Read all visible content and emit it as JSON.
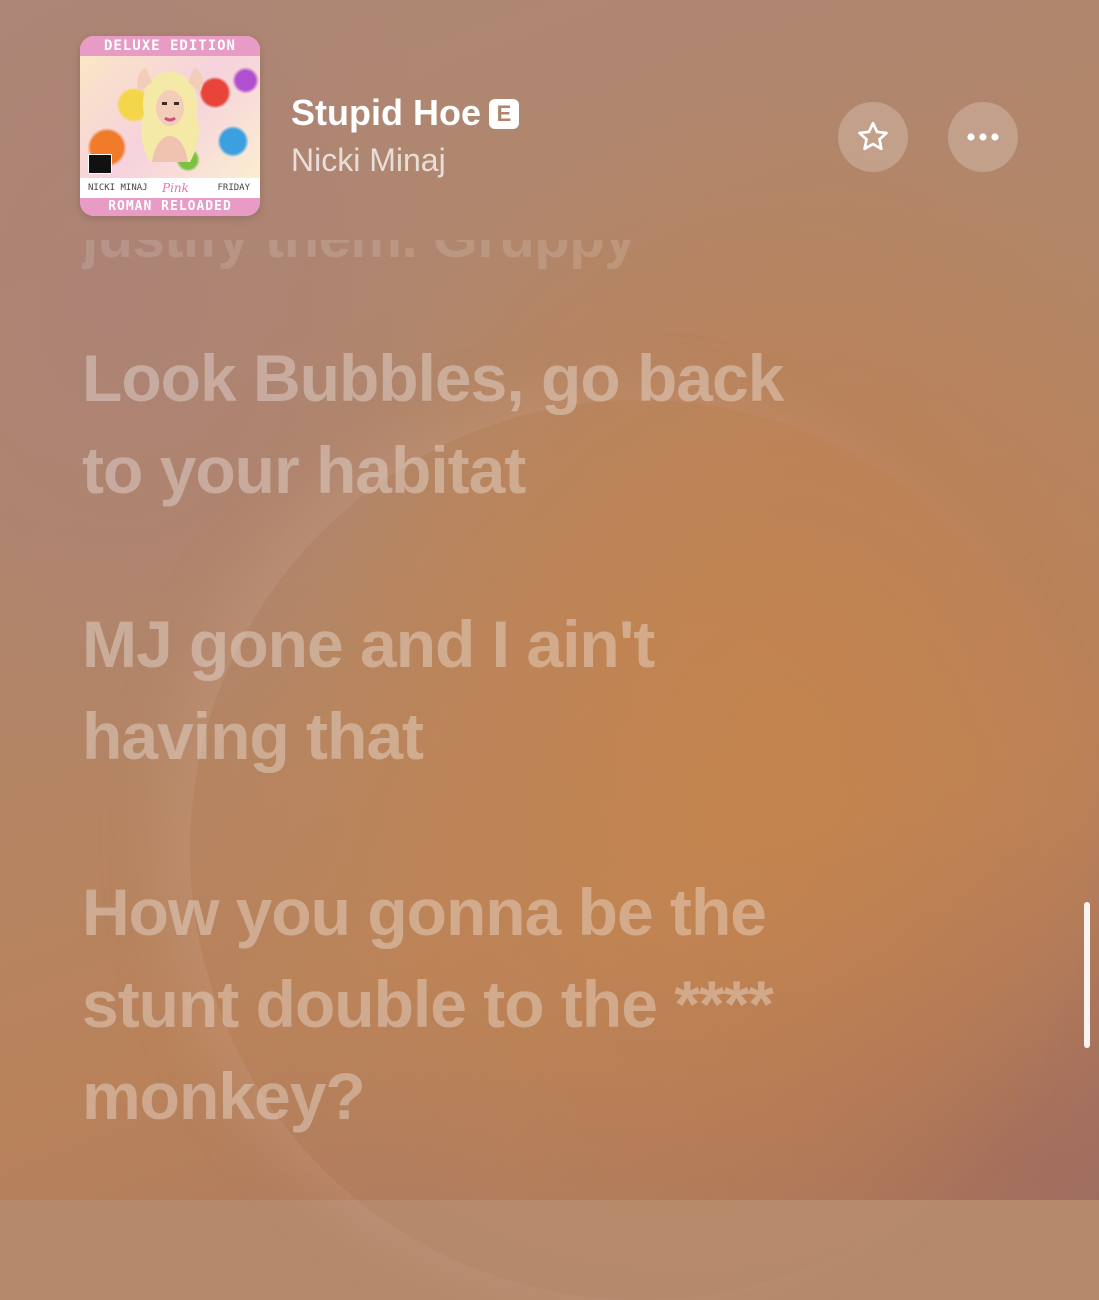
{
  "now_playing": {
    "title": "Stupid Hoe",
    "explicit_badge": "E",
    "artist": "Nicki Minaj",
    "album_art": {
      "top_text": "DELUXE EDITION",
      "left_text": "NICKI MINAJ",
      "center_text": "Pink",
      "right_text": "FRIDAY",
      "bottom_text": "ROMAN RELOADED"
    }
  },
  "actions": {
    "favorite_icon": "star-icon",
    "more_icon": "ellipsis-icon"
  },
  "lyrics": {
    "partial_line": "justify them. Gruppy",
    "lines": [
      [
        "Look Bubbles, go back",
        "to your habitat"
      ],
      [
        "MJ gone and I ain't",
        "having that"
      ],
      [
        "How you gonna be the",
        "stunt double to the ****",
        "monkey?"
      ]
    ]
  },
  "colors": {
    "background": "#b58a6c",
    "text": "#ffffff",
    "lyric_dim": "rgba(255,255,255,0.32)",
    "art_accent": "#e89bc5"
  }
}
